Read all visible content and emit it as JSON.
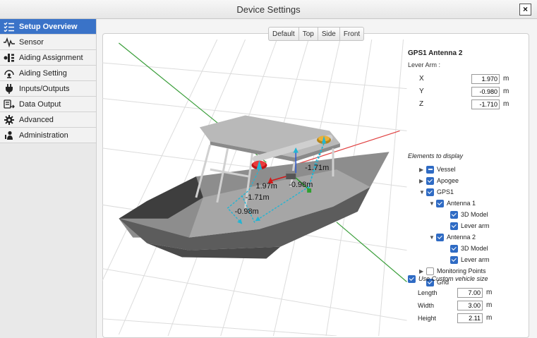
{
  "window": {
    "title": "Device Settings",
    "close_glyph": "×"
  },
  "sidebar": {
    "items": [
      {
        "label": "Setup Overview",
        "icon": "checklist-icon",
        "active": true
      },
      {
        "label": "Sensor",
        "icon": "waveform-icon"
      },
      {
        "label": "Aiding Assignment",
        "icon": "assignment-icon"
      },
      {
        "label": "Aiding Setting",
        "icon": "satellite-icon"
      },
      {
        "label": "Inputs/Outputs",
        "icon": "plug-icon"
      },
      {
        "label": "Data Output",
        "icon": "data-output-icon"
      },
      {
        "label": "Advanced",
        "icon": "gear-icon"
      },
      {
        "label": "Administration",
        "icon": "admin-icon"
      }
    ]
  },
  "view_tabs": [
    "Default",
    "Top",
    "Side",
    "Front"
  ],
  "viewport": {
    "labels": {
      "x_top": "1.97m",
      "y_top": "-0.98m",
      "z_top": "-1.71m",
      "z_front": "-1.71m",
      "y_front": "-0.98m"
    }
  },
  "properties": {
    "heading": "GPS1 Antenna 2",
    "lever_arm_label": "Lever Arm :",
    "fields": [
      {
        "label": "X",
        "value": "1.970",
        "unit": "m"
      },
      {
        "label": "Y",
        "value": "-0.980",
        "unit": "m"
      },
      {
        "label": "Z",
        "value": "-1.710",
        "unit": "m"
      }
    ]
  },
  "elements": {
    "title": "Elements to display",
    "items": [
      {
        "label": "Vessel",
        "toggle": "▶",
        "state": "partial",
        "indent": 0
      },
      {
        "label": "Apogee",
        "toggle": "▶",
        "state": "on",
        "indent": 0
      },
      {
        "label": "GPS1",
        "toggle": "▼",
        "state": "on",
        "indent": 0
      },
      {
        "label": "Antenna 1",
        "toggle": "▼",
        "state": "on",
        "indent": 1
      },
      {
        "label": "3D Model",
        "toggle": "",
        "state": "on",
        "indent": 2
      },
      {
        "label": "Lever arm",
        "toggle": "",
        "state": "on",
        "indent": 2
      },
      {
        "label": "Antenna 2",
        "toggle": "▼",
        "state": "on",
        "indent": 1
      },
      {
        "label": "3D Model",
        "toggle": "",
        "state": "on",
        "indent": 2
      },
      {
        "label": "Lever arm",
        "toggle": "",
        "state": "on",
        "indent": 2
      },
      {
        "label": "Monitoring Points",
        "toggle": "▶",
        "state": "off",
        "indent": 0
      },
      {
        "label": "Grid",
        "toggle": "",
        "state": "on",
        "indent": 0
      }
    ]
  },
  "vehicle_size": {
    "custom_label": "Use Custom vehicle size",
    "checked": true,
    "fields": [
      {
        "label": "Length",
        "value": "7.00",
        "unit": "m"
      },
      {
        "label": "Width",
        "value": "3.00",
        "unit": "m"
      },
      {
        "label": "Height",
        "value": "2.11",
        "unit": "m"
      }
    ]
  },
  "colors": {
    "accent": "#3a73c8",
    "checkbox": "#2f6bc4",
    "cyan_arrow": "#23b5d3",
    "antenna_red": "#d11a1a",
    "antenna_orange": "#e0a226"
  }
}
